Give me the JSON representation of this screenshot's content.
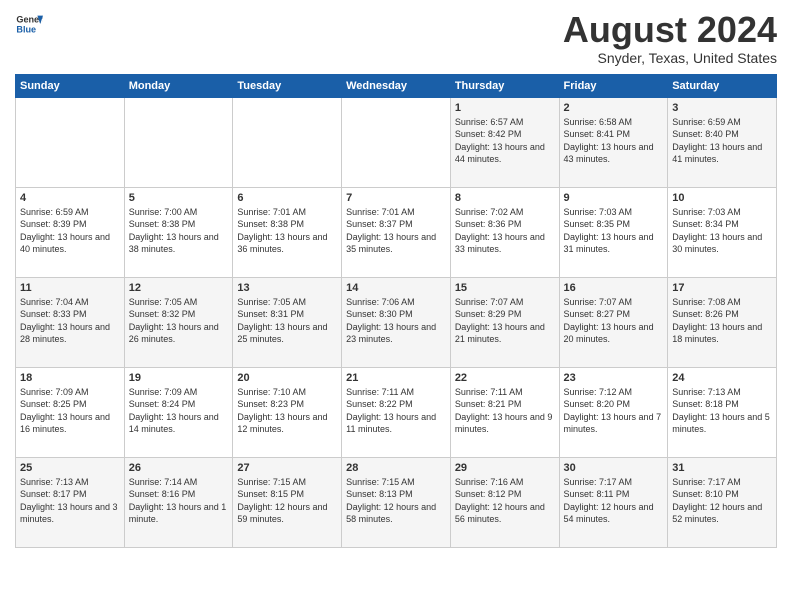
{
  "header": {
    "logo_line1": "General",
    "logo_line2": "Blue",
    "title": "August 2024",
    "subtitle": "Snyder, Texas, United States"
  },
  "weekdays": [
    "Sunday",
    "Monday",
    "Tuesday",
    "Wednesday",
    "Thursday",
    "Friday",
    "Saturday"
  ],
  "weeks": [
    [
      {
        "day": "",
        "sunrise": "",
        "sunset": "",
        "daylight": ""
      },
      {
        "day": "",
        "sunrise": "",
        "sunset": "",
        "daylight": ""
      },
      {
        "day": "",
        "sunrise": "",
        "sunset": "",
        "daylight": ""
      },
      {
        "day": "",
        "sunrise": "",
        "sunset": "",
        "daylight": ""
      },
      {
        "day": "1",
        "sunrise": "Sunrise: 6:57 AM",
        "sunset": "Sunset: 8:42 PM",
        "daylight": "Daylight: 13 hours and 44 minutes."
      },
      {
        "day": "2",
        "sunrise": "Sunrise: 6:58 AM",
        "sunset": "Sunset: 8:41 PM",
        "daylight": "Daylight: 13 hours and 43 minutes."
      },
      {
        "day": "3",
        "sunrise": "Sunrise: 6:59 AM",
        "sunset": "Sunset: 8:40 PM",
        "daylight": "Daylight: 13 hours and 41 minutes."
      }
    ],
    [
      {
        "day": "4",
        "sunrise": "Sunrise: 6:59 AM",
        "sunset": "Sunset: 8:39 PM",
        "daylight": "Daylight: 13 hours and 40 minutes."
      },
      {
        "day": "5",
        "sunrise": "Sunrise: 7:00 AM",
        "sunset": "Sunset: 8:38 PM",
        "daylight": "Daylight: 13 hours and 38 minutes."
      },
      {
        "day": "6",
        "sunrise": "Sunrise: 7:01 AM",
        "sunset": "Sunset: 8:38 PM",
        "daylight": "Daylight: 13 hours and 36 minutes."
      },
      {
        "day": "7",
        "sunrise": "Sunrise: 7:01 AM",
        "sunset": "Sunset: 8:37 PM",
        "daylight": "Daylight: 13 hours and 35 minutes."
      },
      {
        "day": "8",
        "sunrise": "Sunrise: 7:02 AM",
        "sunset": "Sunset: 8:36 PM",
        "daylight": "Daylight: 13 hours and 33 minutes."
      },
      {
        "day": "9",
        "sunrise": "Sunrise: 7:03 AM",
        "sunset": "Sunset: 8:35 PM",
        "daylight": "Daylight: 13 hours and 31 minutes."
      },
      {
        "day": "10",
        "sunrise": "Sunrise: 7:03 AM",
        "sunset": "Sunset: 8:34 PM",
        "daylight": "Daylight: 13 hours and 30 minutes."
      }
    ],
    [
      {
        "day": "11",
        "sunrise": "Sunrise: 7:04 AM",
        "sunset": "Sunset: 8:33 PM",
        "daylight": "Daylight: 13 hours and 28 minutes."
      },
      {
        "day": "12",
        "sunrise": "Sunrise: 7:05 AM",
        "sunset": "Sunset: 8:32 PM",
        "daylight": "Daylight: 13 hours and 26 minutes."
      },
      {
        "day": "13",
        "sunrise": "Sunrise: 7:05 AM",
        "sunset": "Sunset: 8:31 PM",
        "daylight": "Daylight: 13 hours and 25 minutes."
      },
      {
        "day": "14",
        "sunrise": "Sunrise: 7:06 AM",
        "sunset": "Sunset: 8:30 PM",
        "daylight": "Daylight: 13 hours and 23 minutes."
      },
      {
        "day": "15",
        "sunrise": "Sunrise: 7:07 AM",
        "sunset": "Sunset: 8:29 PM",
        "daylight": "Daylight: 13 hours and 21 minutes."
      },
      {
        "day": "16",
        "sunrise": "Sunrise: 7:07 AM",
        "sunset": "Sunset: 8:27 PM",
        "daylight": "Daylight: 13 hours and 20 minutes."
      },
      {
        "day": "17",
        "sunrise": "Sunrise: 7:08 AM",
        "sunset": "Sunset: 8:26 PM",
        "daylight": "Daylight: 13 hours and 18 minutes."
      }
    ],
    [
      {
        "day": "18",
        "sunrise": "Sunrise: 7:09 AM",
        "sunset": "Sunset: 8:25 PM",
        "daylight": "Daylight: 13 hours and 16 minutes."
      },
      {
        "day": "19",
        "sunrise": "Sunrise: 7:09 AM",
        "sunset": "Sunset: 8:24 PM",
        "daylight": "Daylight: 13 hours and 14 minutes."
      },
      {
        "day": "20",
        "sunrise": "Sunrise: 7:10 AM",
        "sunset": "Sunset: 8:23 PM",
        "daylight": "Daylight: 13 hours and 12 minutes."
      },
      {
        "day": "21",
        "sunrise": "Sunrise: 7:11 AM",
        "sunset": "Sunset: 8:22 PM",
        "daylight": "Daylight: 13 hours and 11 minutes."
      },
      {
        "day": "22",
        "sunrise": "Sunrise: 7:11 AM",
        "sunset": "Sunset: 8:21 PM",
        "daylight": "Daylight: 13 hours and 9 minutes."
      },
      {
        "day": "23",
        "sunrise": "Sunrise: 7:12 AM",
        "sunset": "Sunset: 8:20 PM",
        "daylight": "Daylight: 13 hours and 7 minutes."
      },
      {
        "day": "24",
        "sunrise": "Sunrise: 7:13 AM",
        "sunset": "Sunset: 8:18 PM",
        "daylight": "Daylight: 13 hours and 5 minutes."
      }
    ],
    [
      {
        "day": "25",
        "sunrise": "Sunrise: 7:13 AM",
        "sunset": "Sunset: 8:17 PM",
        "daylight": "Daylight: 13 hours and 3 minutes."
      },
      {
        "day": "26",
        "sunrise": "Sunrise: 7:14 AM",
        "sunset": "Sunset: 8:16 PM",
        "daylight": "Daylight: 13 hours and 1 minute."
      },
      {
        "day": "27",
        "sunrise": "Sunrise: 7:15 AM",
        "sunset": "Sunset: 8:15 PM",
        "daylight": "Daylight: 12 hours and 59 minutes."
      },
      {
        "day": "28",
        "sunrise": "Sunrise: 7:15 AM",
        "sunset": "Sunset: 8:13 PM",
        "daylight": "Daylight: 12 hours and 58 minutes."
      },
      {
        "day": "29",
        "sunrise": "Sunrise: 7:16 AM",
        "sunset": "Sunset: 8:12 PM",
        "daylight": "Daylight: 12 hours and 56 minutes."
      },
      {
        "day": "30",
        "sunrise": "Sunrise: 7:17 AM",
        "sunset": "Sunset: 8:11 PM",
        "daylight": "Daylight: 12 hours and 54 minutes."
      },
      {
        "day": "31",
        "sunrise": "Sunrise: 7:17 AM",
        "sunset": "Sunset: 8:10 PM",
        "daylight": "Daylight: 12 hours and 52 minutes."
      }
    ]
  ]
}
